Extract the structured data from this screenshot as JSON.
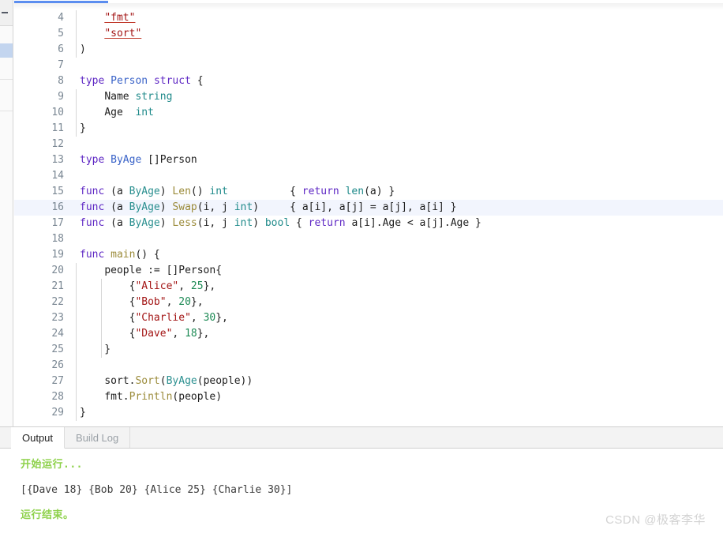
{
  "window": {
    "accent_color": "#5b8def",
    "highlight_line": 16
  },
  "left_rail": {
    "collapse_icon": "minus-icon"
  },
  "editor": {
    "language": "go",
    "first_visible_line": 4,
    "lines": [
      {
        "n": 4,
        "text": "    \"fmt\""
      },
      {
        "n": 5,
        "text": "    \"sort\""
      },
      {
        "n": 6,
        "text": ")"
      },
      {
        "n": 7,
        "text": ""
      },
      {
        "n": 8,
        "text": "type Person struct {"
      },
      {
        "n": 9,
        "text": "    Name string"
      },
      {
        "n": 10,
        "text": "    Age  int"
      },
      {
        "n": 11,
        "text": "}"
      },
      {
        "n": 12,
        "text": ""
      },
      {
        "n": 13,
        "text": "type ByAge []Person"
      },
      {
        "n": 14,
        "text": ""
      },
      {
        "n": 15,
        "text": "func (a ByAge) Len() int          { return len(a) }"
      },
      {
        "n": 16,
        "text": "func (a ByAge) Swap(i, j int)     { a[i], a[j] = a[j], a[i] }"
      },
      {
        "n": 17,
        "text": "func (a ByAge) Less(i, j int) bool { return a[i].Age < a[j].Age }"
      },
      {
        "n": 18,
        "text": ""
      },
      {
        "n": 19,
        "text": "func main() {"
      },
      {
        "n": 20,
        "text": "    people := []Person{"
      },
      {
        "n": 21,
        "text": "        {\"Alice\", 25},"
      },
      {
        "n": 22,
        "text": "        {\"Bob\", 20},"
      },
      {
        "n": 23,
        "text": "        {\"Charlie\", 30},"
      },
      {
        "n": 24,
        "text": "        {\"Dave\", 18},"
      },
      {
        "n": 25,
        "text": "    }"
      },
      {
        "n": 26,
        "text": ""
      },
      {
        "n": 27,
        "text": "    sort.Sort(ByAge(people))"
      },
      {
        "n": 28,
        "text": "    fmt.Println(people)"
      },
      {
        "n": 29,
        "text": "}"
      }
    ]
  },
  "bottom_panel": {
    "tabs": [
      {
        "label": "Output",
        "active": true
      },
      {
        "label": "Build Log",
        "active": false
      }
    ],
    "console": {
      "start_message": "开始运行...",
      "result_line": "[{Dave 18} {Bob 20} {Alice 25} {Charlie 30}]",
      "end_message": "运行结束。",
      "status_color": "#8ed14b"
    }
  },
  "watermark": {
    "text": "CSDN @极客李华"
  }
}
